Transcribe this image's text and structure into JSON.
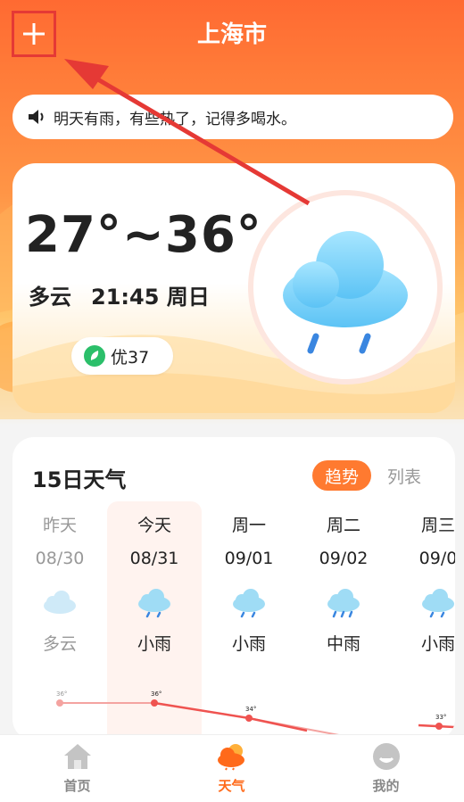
{
  "header": {
    "title": "上海市",
    "add_icon": "plus-icon"
  },
  "notice": {
    "icon": "speaker-icon",
    "text": "明天有雨，有些热了，记得多喝水。"
  },
  "current": {
    "temp_range": "27°~36°",
    "condition": "多云",
    "time_day": "21:45 周日",
    "aqi_icon": "leaf-icon",
    "aqi": "优37",
    "weather_icon": "rain-cloud-icon"
  },
  "forecast": {
    "title": "15日天气",
    "tabs": {
      "trend": "趋势",
      "list": "列表"
    },
    "days": [
      {
        "name": "昨天",
        "date": "08/30",
        "cond": "多云",
        "icon": "cloud-icon",
        "temp": "36°"
      },
      {
        "name": "今天",
        "date": "08/31",
        "cond": "小雨",
        "icon": "light-rain-icon",
        "temp": "36°"
      },
      {
        "name": "周一",
        "date": "09/01",
        "cond": "小雨",
        "icon": "light-rain-icon",
        "temp": "34°"
      },
      {
        "name": "周二",
        "date": "09/02",
        "cond": "中雨",
        "icon": "moderate-rain-icon",
        "temp": ""
      },
      {
        "name": "周三",
        "date": "09/0",
        "cond": "小雨",
        "icon": "light-rain-icon",
        "temp": "33°"
      }
    ]
  },
  "nav": {
    "items": [
      {
        "label": "首页",
        "icon": "home-icon",
        "active": false
      },
      {
        "label": "天气",
        "icon": "weather-icon",
        "active": true
      },
      {
        "label": "我的",
        "icon": "profile-icon",
        "active": false
      }
    ],
    "active_color": "#ff6a1a",
    "inactive_color": "#aaaaaa"
  },
  "colors": {
    "accent": "#ff7a30",
    "highlight_box": "#e53935"
  }
}
